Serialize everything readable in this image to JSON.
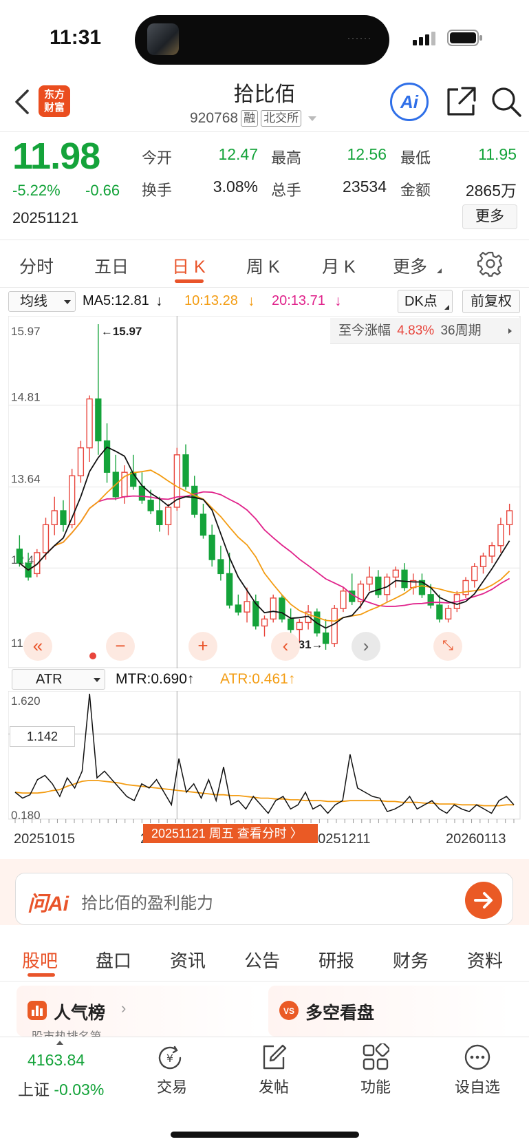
{
  "status": {
    "time": "11:31",
    "island_dots": "······"
  },
  "header": {
    "app_logo": "东方\n财富",
    "stock_name": "拾比佰",
    "code": "920768",
    "tag_margin": "融",
    "tag_exchange": "北交所",
    "ai_label": "Ai"
  },
  "quote": {
    "price": "11.98",
    "change_pct": "-5.22%",
    "change": "-0.66",
    "date": "20251121",
    "open_label": "今开",
    "open": "12.47",
    "high_label": "最高",
    "high": "12.56",
    "low_label": "最低",
    "low": "11.95",
    "turnover_label": "换手",
    "turnover": "3.08%",
    "volume_label": "总手",
    "volume": "23534",
    "amount_label": "金额",
    "amount": "2865万",
    "more_label": "更多"
  },
  "tabs": [
    "分时",
    "五日",
    "日 K",
    "周 K",
    "月 K",
    "更多"
  ],
  "chart_header": {
    "indicator": "均线",
    "ma5": "MA5:12.81",
    "ma10": "10:13.28",
    "ma20": "20:13.71",
    "dk": "DK点",
    "adjust": "前复权",
    "range_label": "至今涨幅",
    "range_value": "4.83%",
    "range_period": "36周期"
  },
  "colors": {
    "up": "#e8453c",
    "down": "#14a33a",
    "accent": "#e9542a",
    "ma5": "#111111",
    "ma10": "#f39c12",
    "ma20": "#e0218a"
  },
  "chart_data": [
    {
      "type": "candlestick",
      "y_ticks": [
        "15.97",
        "14.81",
        "13.64",
        "12.48",
        "11.31"
      ],
      "ylim": [
        11.31,
        15.97
      ],
      "max_label": "←15.97",
      "min_label": "11.31→",
      "candles": [
        [
          12.75,
          12.95,
          12.5,
          12.55
        ],
        [
          12.55,
          12.7,
          12.3,
          12.35
        ],
        [
          12.4,
          12.75,
          12.35,
          12.7
        ],
        [
          12.7,
          13.2,
          12.6,
          13.1
        ],
        [
          13.1,
          13.5,
          12.95,
          13.3
        ],
        [
          13.3,
          13.45,
          13.0,
          13.1
        ],
        [
          13.1,
          13.9,
          13.05,
          13.8
        ],
        [
          13.8,
          14.3,
          13.7,
          14.2
        ],
        [
          14.2,
          14.95,
          14.0,
          14.9
        ],
        [
          14.9,
          15.97,
          14.1,
          14.3
        ],
        [
          14.3,
          14.55,
          13.7,
          13.85
        ],
        [
          13.85,
          14.1,
          13.45,
          13.5
        ],
        [
          13.5,
          13.95,
          13.4,
          13.85
        ],
        [
          13.85,
          14.1,
          13.6,
          13.65
        ],
        [
          13.65,
          13.85,
          13.4,
          13.45
        ],
        [
          13.45,
          13.6,
          13.25,
          13.3
        ],
        [
          13.3,
          13.5,
          13.0,
          13.1
        ],
        [
          13.1,
          13.4,
          12.95,
          13.35
        ],
        [
          13.35,
          14.2,
          13.3,
          14.1
        ],
        [
          14.1,
          14.25,
          13.6,
          13.65
        ],
        [
          13.65,
          13.8,
          13.2,
          13.25
        ],
        [
          13.25,
          13.4,
          12.9,
          12.95
        ],
        [
          12.95,
          13.1,
          12.5,
          12.6
        ],
        [
          12.6,
          12.8,
          12.3,
          12.4
        ],
        [
          12.4,
          12.7,
          11.9,
          11.95
        ],
        [
          11.95,
          12.1,
          11.8,
          11.85
        ],
        [
          11.85,
          12.2,
          11.7,
          12.0
        ],
        [
          12.0,
          12.1,
          11.6,
          11.65
        ],
        [
          11.65,
          11.8,
          11.5,
          11.75
        ],
        [
          11.75,
          12.1,
          11.7,
          12.05
        ],
        [
          12.05,
          12.1,
          11.7,
          11.75
        ],
        [
          11.75,
          11.9,
          11.55,
          11.6
        ],
        [
          11.6,
          11.75,
          11.4,
          11.7
        ],
        [
          11.7,
          11.95,
          11.6,
          11.85
        ],
        [
          11.85,
          11.9,
          11.5,
          11.55
        ],
        [
          11.55,
          11.75,
          11.31,
          11.4
        ],
        [
          11.4,
          11.95,
          11.35,
          11.9
        ],
        [
          11.9,
          12.2,
          11.85,
          12.15
        ],
        [
          12.15,
          12.4,
          11.95,
          12.0
        ],
        [
          12.0,
          12.3,
          11.9,
          12.25
        ],
        [
          12.25,
          12.5,
          12.15,
          12.35
        ],
        [
          12.35,
          12.45,
          12.05,
          12.1
        ],
        [
          12.1,
          12.4,
          12.0,
          12.35
        ],
        [
          12.35,
          12.5,
          12.2,
          12.45
        ],
        [
          12.45,
          12.55,
          12.15,
          12.2
        ],
        [
          12.2,
          12.4,
          12.1,
          12.3
        ],
        [
          12.3,
          12.4,
          12.05,
          12.1
        ],
        [
          12.1,
          12.25,
          11.9,
          11.95
        ],
        [
          11.95,
          12.1,
          11.7,
          11.75
        ],
        [
          11.75,
          11.95,
          11.7,
          11.9
        ],
        [
          11.9,
          12.15,
          11.85,
          12.1
        ],
        [
          12.1,
          12.35,
          12.05,
          12.3
        ],
        [
          12.3,
          12.55,
          12.2,
          12.5
        ],
        [
          12.5,
          12.7,
          12.4,
          12.65
        ],
        [
          12.65,
          12.85,
          12.55,
          12.8
        ],
        [
          12.8,
          13.2,
          12.7,
          13.1
        ],
        [
          13.1,
          13.4,
          12.95,
          13.3
        ]
      ]
    },
    {
      "type": "line",
      "name": "ATR",
      "y_ticks": [
        "1.620",
        "1.142",
        "0.180"
      ],
      "ylim": [
        0.18,
        1.62
      ],
      "mtr": [
        0.45,
        0.38,
        0.42,
        0.6,
        0.65,
        0.55,
        0.4,
        0.62,
        0.5,
        0.7,
        1.62,
        0.62,
        0.7,
        0.6,
        0.5,
        0.4,
        0.35,
        0.55,
        0.5,
        0.6,
        0.45,
        0.3,
        0.85,
        0.45,
        0.55,
        0.38,
        0.6,
        0.35,
        0.75,
        0.3,
        0.35,
        0.25,
        0.4,
        0.3,
        0.2,
        0.35,
        0.4,
        0.25,
        0.3,
        0.45,
        0.25,
        0.3,
        0.2,
        0.3,
        0.35,
        0.9,
        0.5,
        0.45,
        0.4,
        0.38,
        0.22,
        0.25,
        0.3,
        0.4,
        0.25,
        0.3,
        0.35,
        0.25,
        0.2,
        0.3,
        0.25,
        0.22,
        0.3,
        0.25,
        0.2,
        0.35,
        0.4,
        0.3
      ],
      "atr": [
        0.45,
        0.44,
        0.44,
        0.44,
        0.45,
        0.47,
        0.48,
        0.52,
        0.55,
        0.58,
        0.59,
        0.59,
        0.58,
        0.57,
        0.56,
        0.54,
        0.53,
        0.52,
        0.51,
        0.5,
        0.49,
        0.48,
        0.47,
        0.46,
        0.45,
        0.44,
        0.43,
        0.42,
        0.42,
        0.41,
        0.41,
        0.4,
        0.39,
        0.38,
        0.38,
        0.37,
        0.37,
        0.36,
        0.36,
        0.35,
        0.35,
        0.35,
        0.34,
        0.34,
        0.34,
        0.35,
        0.35,
        0.35,
        0.35,
        0.35,
        0.34,
        0.34,
        0.33,
        0.33,
        0.33,
        0.32,
        0.32,
        0.31,
        0.31,
        0.31,
        0.3,
        0.3,
        0.3,
        0.29,
        0.29,
        0.29,
        0.3,
        0.3
      ]
    }
  ],
  "chart_controls": {
    "zoom_out": "−",
    "zoom_in": "+",
    "prev": "‹",
    "next": "›"
  },
  "atr_header": {
    "indicator": "ATR",
    "mtr": "MTR:0.690↑",
    "atr": "ATR:0.461↑",
    "marker_value": "1.142"
  },
  "x_ticks": [
    "20251015",
    "20251112",
    "20251211",
    "20260113"
  ],
  "date_pill": "20251121 周五 查看分时 〉",
  "ai": {
    "logo": "问Ai",
    "placeholder": "拾比佰的盈利能力"
  },
  "bottom_tabs": [
    "股吧",
    "盘口",
    "资讯",
    "公告",
    "研报",
    "财务",
    "资料"
  ],
  "cards": {
    "left": "人气榜",
    "right": "多空看盘",
    "left_sub": "·股市热排名第..."
  },
  "bottom_nav": {
    "index_value": "4163.84",
    "index_name": "上证",
    "index_change": "-0.03%",
    "trade": "交易",
    "post": "发帖",
    "functions": "功能",
    "watchlist": "设自选"
  }
}
